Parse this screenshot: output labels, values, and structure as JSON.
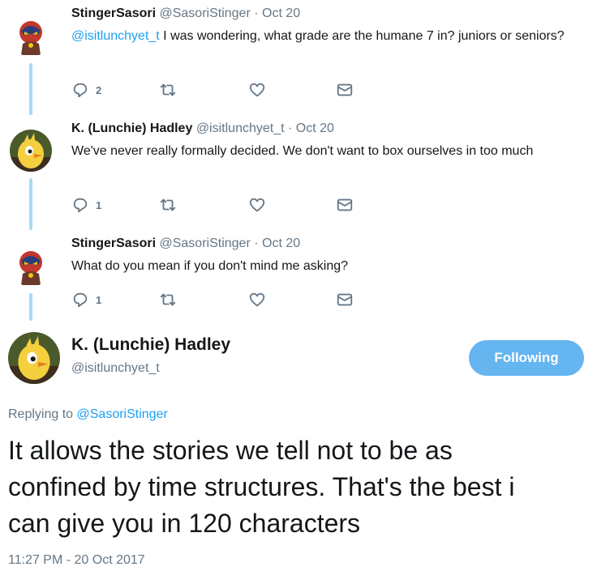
{
  "replies": [
    {
      "name": "StingerSasori",
      "handle": "@SasoriStinger",
      "separator": "·",
      "time": "Oct 20",
      "mention": "@isitlunchyet_t",
      "text": " I was wondering, what grade are the humane 7 in? juniors or seniors?",
      "reply_count": "2",
      "avatar_icon": "masked-hero-avatar"
    },
    {
      "name": "K. (Lunchie) Hadley",
      "handle": "@isitlunchyet_t",
      "separator": "·",
      "time": "Oct 20",
      "text": "We've never really formally decided. We don't want to box ourselves in too much",
      "reply_count": "1",
      "avatar_icon": "yellow-bird-avatar"
    },
    {
      "name": "StingerSasori",
      "handle": "@SasoriStinger",
      "separator": "·",
      "time": "Oct 20",
      "text": "What do you mean if you don't mind me asking?",
      "reply_count": "1",
      "avatar_icon": "masked-hero-avatar"
    }
  ],
  "main_tweet": {
    "name": "K. (Lunchie) Hadley",
    "handle": "@isitlunchyet_t",
    "follow_label": "Following",
    "replying_prefix": "Replying to ",
    "replying_mention": "@SasoriStinger",
    "text_lines": [
      "It allows the stories we tell not to be as",
      "confined by time structures. That's the best i",
      "can give you in 120 characters"
    ],
    "timestamp": "11:27 PM - 20 Oct 2017"
  },
  "icons": {
    "reply": "reply-icon",
    "retweet": "retweet-icon",
    "like": "heart-icon",
    "message": "envelope-icon"
  },
  "colors": {
    "link": "#1da1f2",
    "thread_line": "#a8d9f7",
    "secondary_text": "#657786",
    "follow_button": "#64b5f0"
  }
}
